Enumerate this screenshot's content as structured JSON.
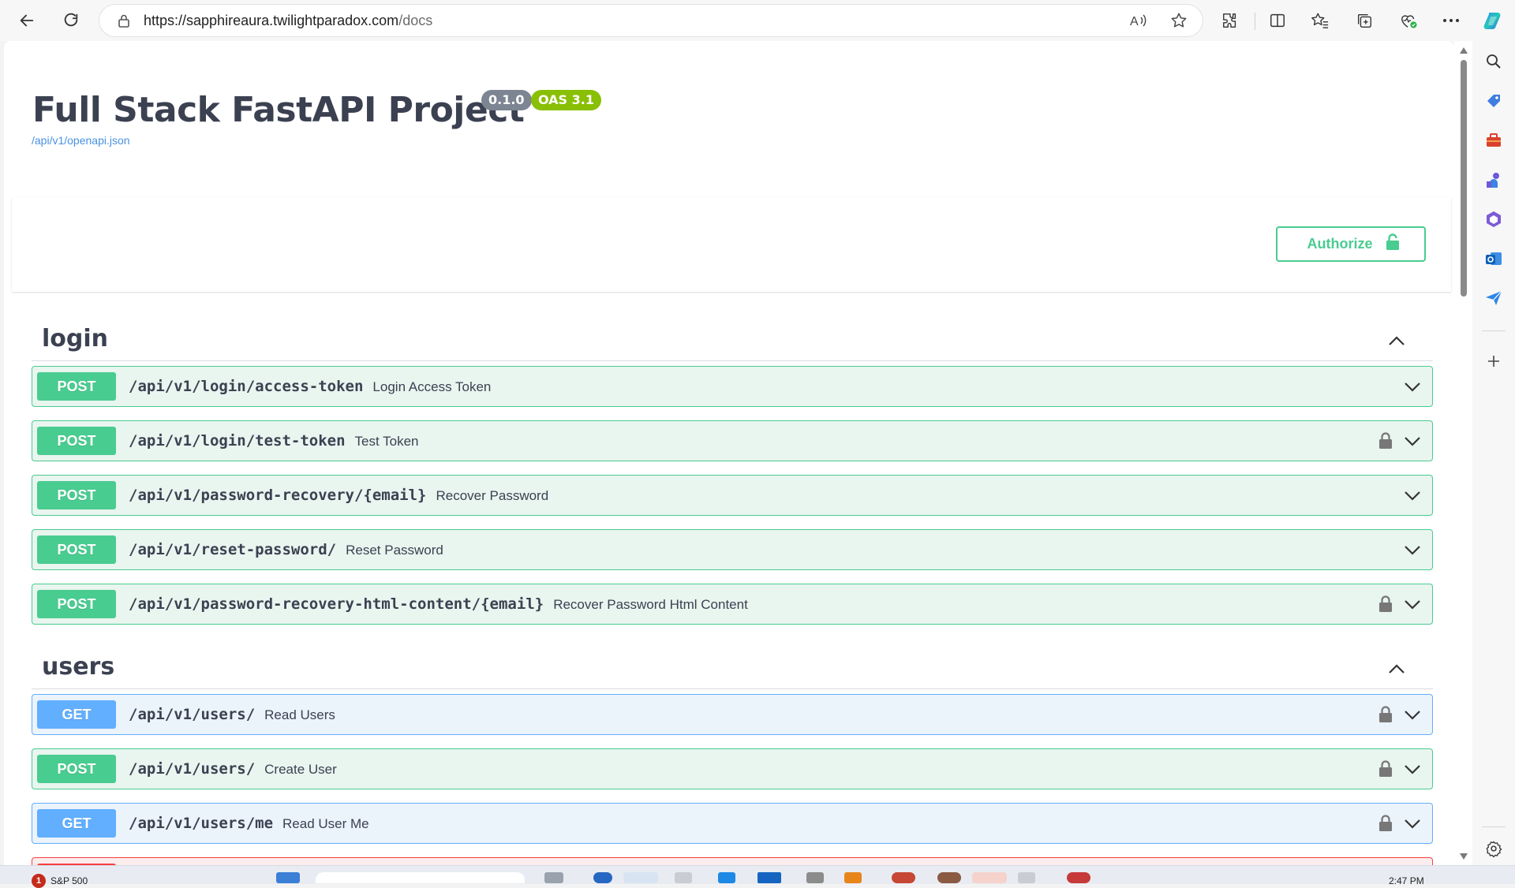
{
  "browser": {
    "url_host": "https://sapphireaura.twilightparadox.com",
    "url_path": "/docs",
    "toolbar_icons": [
      "back-icon",
      "refresh-icon",
      "read-aloud-icon",
      "favorite-star-icon",
      "extensions-icon",
      "split-screen-icon",
      "favorites-icon",
      "collections-icon",
      "browser-essentials-icon",
      "more-icon",
      "copilot-icon"
    ],
    "side_icons": [
      "search-icon",
      "shopping-icon",
      "tools-icon",
      "games-icon",
      "microsoft-365-icon",
      "outlook-icon",
      "send-icon",
      "add-icon",
      "settings-icon"
    ]
  },
  "api": {
    "title": "Full Stack FastAPI Project",
    "version": "0.1.0",
    "oas": "OAS 3.1",
    "spec_url": "/api/v1/openapi.json",
    "authorize_label": "Authorize"
  },
  "tags": [
    {
      "name": "login",
      "operations": [
        {
          "method": "POST",
          "path": "/api/v1/login/access-token",
          "summary": "Login Access Token",
          "locked": false
        },
        {
          "method": "POST",
          "path": "/api/v1/login/test-token",
          "summary": "Test Token",
          "locked": true
        },
        {
          "method": "POST",
          "path": "/api/v1/password-recovery/{email}",
          "summary": "Recover Password",
          "locked": false
        },
        {
          "method": "POST",
          "path": "/api/v1/reset-password/",
          "summary": "Reset Password",
          "locked": false
        },
        {
          "method": "POST",
          "path": "/api/v1/password-recovery-html-content/{email}",
          "summary": "Recover Password Html Content",
          "locked": true
        }
      ]
    },
    {
      "name": "users",
      "operations": [
        {
          "method": "GET",
          "path": "/api/v1/users/",
          "summary": "Read Users",
          "locked": true
        },
        {
          "method": "POST",
          "path": "/api/v1/users/",
          "summary": "Create User",
          "locked": true
        },
        {
          "method": "GET",
          "path": "/api/v1/users/me",
          "summary": "Read User Me",
          "locked": true
        }
      ]
    }
  ],
  "taskbar": {
    "weather_badge": "1",
    "stock_text": "S&P 500",
    "clock_text": "2:47 PM"
  },
  "colors": {
    "post": "#49cc90",
    "get": "#61affe",
    "delete": "#f93e3e",
    "title": "#3b4151",
    "link": "#4990e2"
  }
}
